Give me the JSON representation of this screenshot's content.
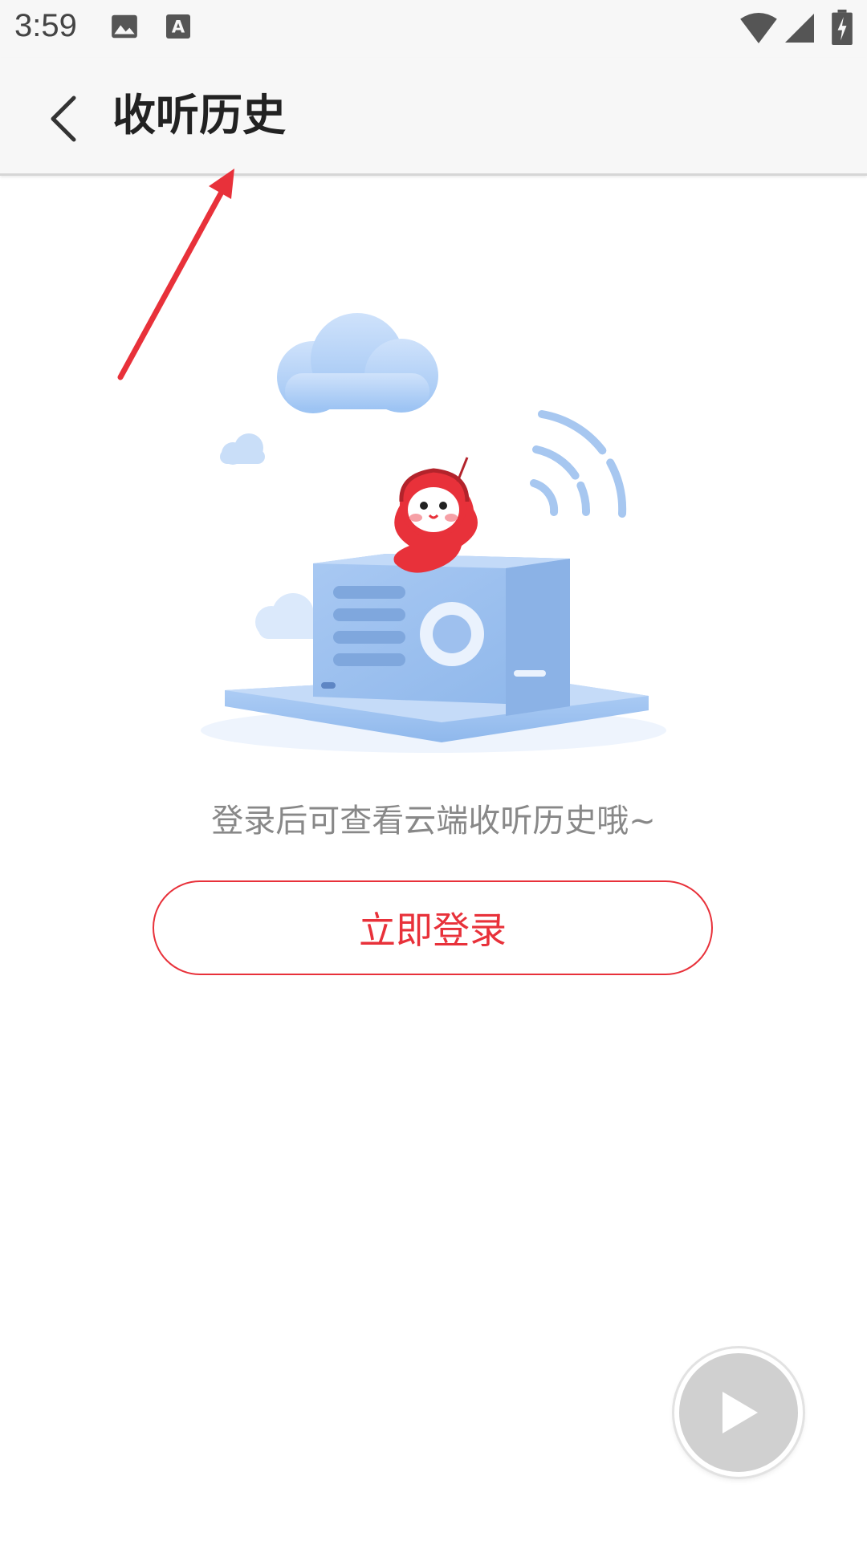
{
  "status_bar": {
    "time": "3:59",
    "icons": [
      "image-icon",
      "a-notification-icon",
      "wifi-icon",
      "signal-icon",
      "battery-charging-icon"
    ]
  },
  "app_bar": {
    "title": "收听历史",
    "back_icon": "chevron-left-icon"
  },
  "empty_state": {
    "illustration": "radio-with-red-mascot-illustration",
    "hint": "登录后可查看云端收听历史哦~",
    "login_button_label": "立即登录"
  },
  "fab": {
    "icon": "play-icon"
  },
  "colors": {
    "accent": "#e8313a",
    "hint_text": "#888888",
    "bar_background": "#f7f7f7",
    "annotation_arrow": "#e8313a"
  }
}
